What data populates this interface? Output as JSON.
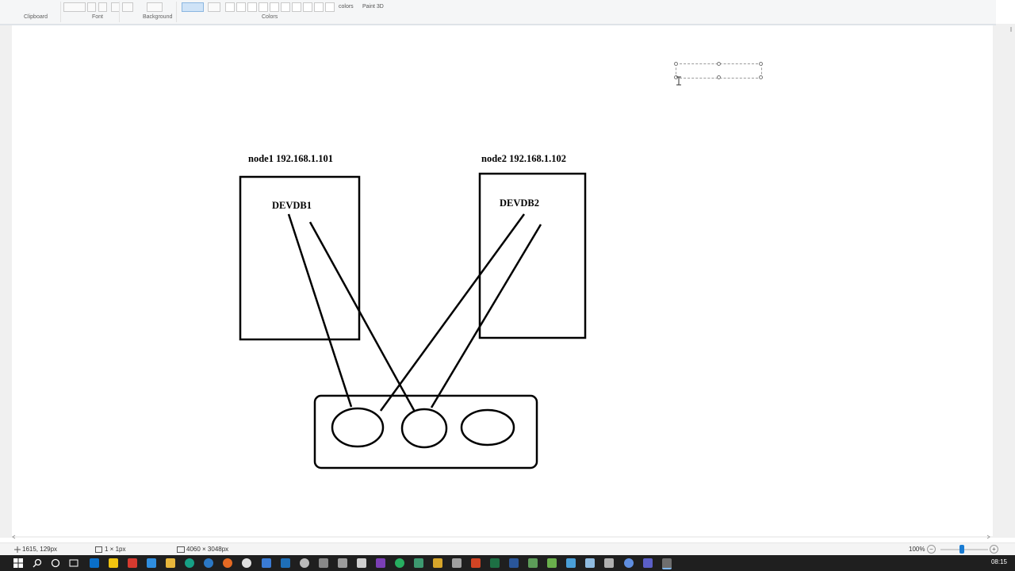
{
  "ribbon": {
    "groups": [
      {
        "label": "Clipboard"
      },
      {
        "label": "Font"
      },
      {
        "label": "Background"
      },
      {
        "label": "Colors"
      }
    ],
    "colors_text": "colors",
    "paint3d_label": "Paint 3D"
  },
  "diagram": {
    "node1_header": "node1 192.168.1.101",
    "node2_header": "node2 192.168.1.102",
    "node1_db": "DEVDB1",
    "node2_db": "DEVDB2"
  },
  "statusbar": {
    "cursor_position": "1615, 129px",
    "selection_size": "1 × 1px",
    "image_size": "4060 × 3048px",
    "zoom": "100%"
  },
  "taskbar": {
    "clock": "08:15",
    "colors": {
      "accent": "#1a7cd3",
      "background": "#1f1f1f"
    }
  }
}
